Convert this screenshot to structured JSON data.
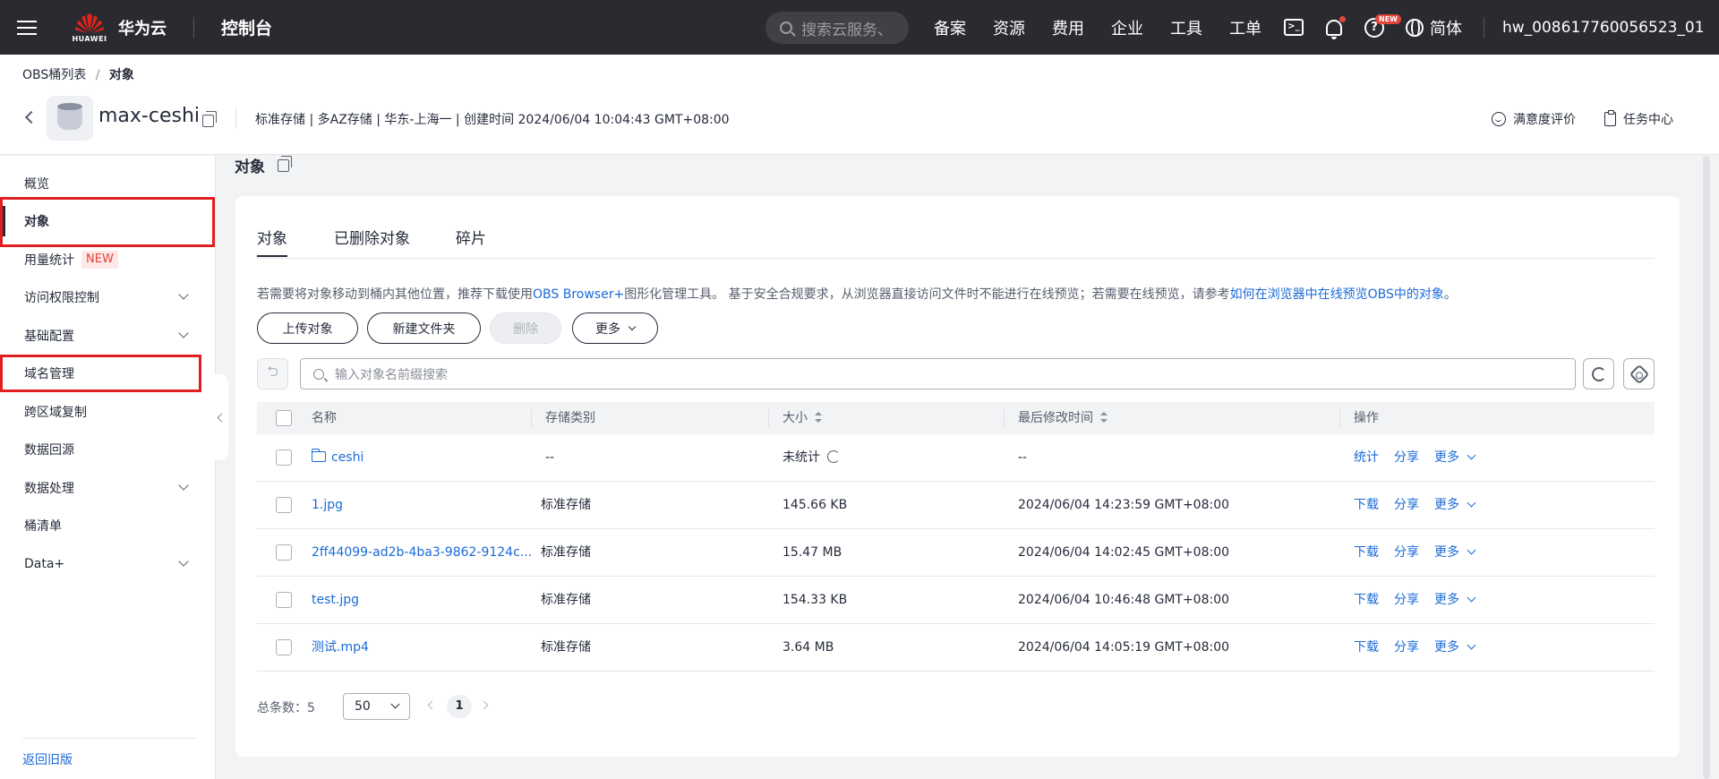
{
  "topbar": {
    "logo_text": "HUAWEI",
    "brand": "华为云",
    "console": "控制台",
    "search_placeholder": "搜索云服务、",
    "nav": [
      "备案",
      "资源",
      "费用",
      "企业",
      "工具",
      "工单"
    ],
    "terminal_glyph": ">_",
    "help_glyph": "?",
    "new_badge": "NEW",
    "language": "简体",
    "username": "hw_008617760056523_01"
  },
  "breadcrumb": {
    "parent": "OBS桶列表",
    "sep": "/",
    "current": "对象"
  },
  "bucket": {
    "name": "max-ceshi",
    "meta": "标准存储 | 多AZ存储 | 华东-上海一 | 创建时间  2024/06/04 10:04:43 GMT+08:00"
  },
  "header_actions": {
    "feedback": "满意度评价",
    "tasks": "任务中心"
  },
  "sidebar": {
    "items": [
      {
        "label": "概览"
      },
      {
        "label": "对象"
      },
      {
        "label": "用量统计",
        "badge": "NEW"
      },
      {
        "label": "访问权限控制"
      },
      {
        "label": "基础配置"
      },
      {
        "label": "域名管理"
      },
      {
        "label": "跨区域复制"
      },
      {
        "label": "数据回源"
      },
      {
        "label": "数据处理"
      },
      {
        "label": "桶清单"
      },
      {
        "label": "Data+"
      }
    ],
    "back_link": "返回旧版"
  },
  "main": {
    "title": "对象",
    "tabs": [
      "对象",
      "已删除对象",
      "碎片"
    ],
    "tip_prefix": "若需要将对象移动到桶内其他位置，推荐下载使用",
    "tip_link1": "OBS Browser+",
    "tip_middle": "图形化管理工具。 基于安全合规要求，从浏览器直接访问文件时不能进行在线预览；若需要在线预览，请参考",
    "tip_link2": "如何在浏览器中在线预览OBS中的对象",
    "tip_suffix": "。",
    "buttons": {
      "upload": "上传对象",
      "new_folder": "新建文件夹",
      "delete": "删除",
      "more": "更多"
    },
    "undo_glyph": "⮌",
    "search_placeholder": "输入对象名前缀搜索",
    "columns": [
      "名称",
      "存储类别",
      "大小",
      "最后修改时间",
      "操作"
    ],
    "rows": [
      {
        "name": "ceshi",
        "storage": "--",
        "size": "未统计",
        "modified": "--",
        "op1": "统计",
        "op2": "分享",
        "op3": "更多"
      },
      {
        "name": "1.jpg",
        "storage": "标准存储",
        "size": "145.66 KB",
        "modified": "2024/06/04 14:23:59 GMT+08:00",
        "op1": "下载",
        "op2": "分享",
        "op3": "更多"
      },
      {
        "name": "2ff44099-ad2b-4ba3-9862-9124c...",
        "storage": "标准存储",
        "size": "15.47 MB",
        "modified": "2024/06/04 14:02:45 GMT+08:00",
        "op1": "下载",
        "op2": "分享",
        "op3": "更多"
      },
      {
        "name": "test.jpg",
        "storage": "标准存储",
        "size": "154.33 KB",
        "modified": "2024/06/04 10:46:48 GMT+08:00",
        "op1": "下载",
        "op2": "分享",
        "op3": "更多"
      },
      {
        "name": "测试.mp4",
        "storage": "标准存储",
        "size": "3.64 MB",
        "modified": "2024/06/04 14:05:19 GMT+08:00",
        "op1": "下载",
        "op2": "分享",
        "op3": "更多"
      }
    ],
    "pager": {
      "total_label": "总条数：5",
      "page_size": "50",
      "current_page": "1"
    }
  },
  "colors": {
    "topbar_bg": "#2a2b30",
    "link": "#1a6ad8",
    "highlight_box": "#e02020",
    "new_badge": "#e2453c"
  }
}
